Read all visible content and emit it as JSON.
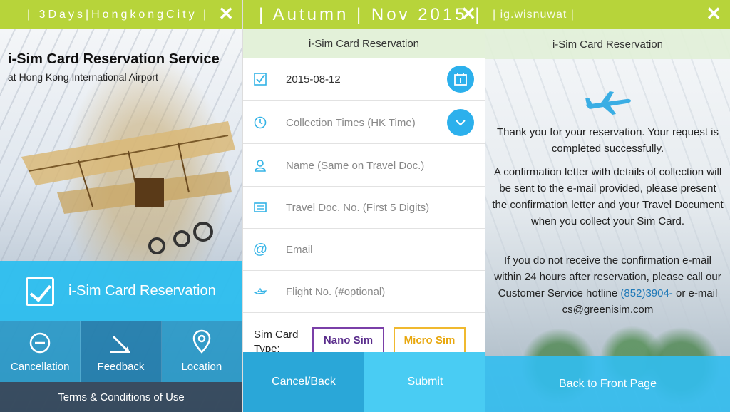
{
  "panel1": {
    "topbar_text": "| 3Days|HongkongCity |",
    "close_label": "✕",
    "title": "i-Sim Card Reservation Service",
    "subtitle": "at Hong Kong International Airport",
    "reservation_label": "i-Sim Card Reservation",
    "actions": [
      {
        "label": "Cancellation",
        "icon": "minus-circle-icon"
      },
      {
        "label": "Feedback",
        "icon": "pencil-icon"
      },
      {
        "label": "Location",
        "icon": "map-pin-icon"
      }
    ],
    "terms_label": "Terms & Conditions of Use"
  },
  "panel2": {
    "topbar_text": "| Autumn | Nov 2015 |",
    "close_label": "✕",
    "header": "i-Sim Card Reservation",
    "date_value": "2015-08-12",
    "collection_placeholder": "Collection Times (HK Time)",
    "name_placeholder": "Name (Same on Travel Doc.)",
    "travel_doc_placeholder": "Travel Doc. No. (First 5 Digits)",
    "email_placeholder": "Email",
    "flight_placeholder": "Flight No. (#optional)",
    "sim_type_label": "Sim Card Type:",
    "nano_label": "Nano Sim",
    "micro_label": "Micro Sim",
    "cancel_label": "Cancel/Back",
    "submit_label": "Submit",
    "accent": "#2cb0ec"
  },
  "panel3": {
    "topbar_text": "| ig.wisnuwat |",
    "close_label": "✕",
    "header": "i-Sim Card Reservation",
    "msg1": "Thank you for your reservation. Your request is completed successfully.",
    "msg2": "A confirmation letter with details of collection will be sent to the e-mail provided, please present the confirmation letter and your Travel Document when you collect your Sim Card.",
    "msg3_a": "If you do not receive the confirmation e-mail within 24 hours after reservation, please call our Customer Service hotline ",
    "msg3_phone": "(852)3904-",
    "msg3_b": " or e-mail cs@greenisim.com",
    "back_label": "Back to Front Page"
  },
  "colors": {
    "topbar": "#b7d43a",
    "blue": "#2cb0ec",
    "nano": "#5a2d8c",
    "micro": "#e8a70d"
  }
}
